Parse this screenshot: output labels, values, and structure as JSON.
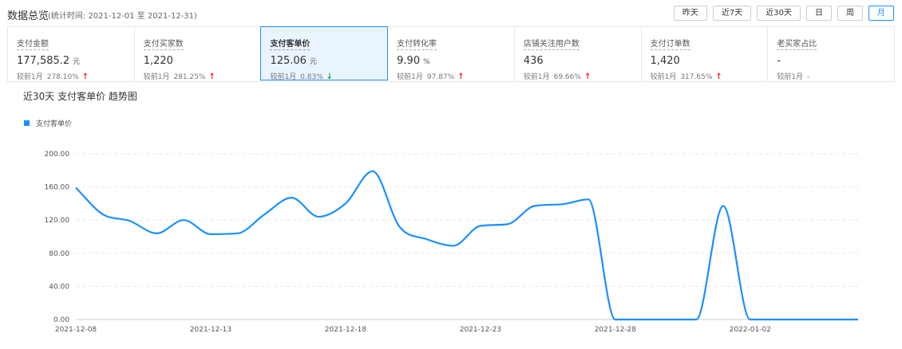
{
  "header": {
    "title": "数据总览",
    "period": "(统计时间: 2021-12-01 至 2021-12-31)",
    "range_buttons": [
      "昨天",
      "近7天",
      "近30天",
      "日",
      "周",
      "月"
    ],
    "active_range": "月"
  },
  "kpis": [
    {
      "name": "支付金额",
      "value": "177,585.2",
      "unit": "元",
      "compare_label": "较前1月",
      "compare_pct": "278.10%",
      "trend": "up"
    },
    {
      "name": "支付买家数",
      "value": "1,220",
      "unit": "",
      "compare_label": "较前1月",
      "compare_pct": "281.25%",
      "trend": "up"
    },
    {
      "name": "支付客单价",
      "value": "125.06",
      "unit": "元",
      "compare_label": "较前1月",
      "compare_pct": "0.83%",
      "trend": "down",
      "active": true
    },
    {
      "name": "支付转化率",
      "value": "9.90",
      "unit": "%",
      "compare_label": "较前1月",
      "compare_pct": "97.87%",
      "trend": "up"
    },
    {
      "name": "店铺关注用户数",
      "value": "436",
      "unit": "",
      "compare_label": "较前1月",
      "compare_pct": "69.66%",
      "trend": "up"
    },
    {
      "name": "支付订单数",
      "value": "1,420",
      "unit": "",
      "compare_label": "较前1月",
      "compare_pct": "317.65%",
      "trend": "up"
    },
    {
      "name": "老买家占比",
      "value": "-",
      "unit": "",
      "compare_label": "较前1月",
      "compare_pct": "-",
      "trend": "none"
    }
  ],
  "chart_title": "近30天 支付客单价 趋势图",
  "legend_label": "支付客单价",
  "colors": {
    "accent": "#1a90ff",
    "up": "#f5222d",
    "down": "#1aa34a"
  },
  "chart_data": {
    "type": "line",
    "title": "近30天 支付客单价 趋势图",
    "xlabel": "",
    "ylabel": "",
    "ylim": [
      0,
      200
    ],
    "y_ticks": [
      "0.00",
      "40.00",
      "80.00",
      "120.00",
      "160.00",
      "200.00"
    ],
    "x_tick_labels": [
      "2021-12-08",
      "2021-12-13",
      "2021-12-18",
      "2021-12-23",
      "2021-12-28",
      "2022-01-02"
    ],
    "grid": true,
    "legend": "top-left",
    "series": [
      {
        "name": "支付客单价",
        "x": [
          "2021-12-08",
          "2021-12-09",
          "2021-12-10",
          "2021-12-11",
          "2021-12-12",
          "2021-12-13",
          "2021-12-14",
          "2021-12-15",
          "2021-12-16",
          "2021-12-17",
          "2021-12-18",
          "2021-12-19",
          "2021-12-20",
          "2021-12-21",
          "2021-12-22",
          "2021-12-23",
          "2021-12-24",
          "2021-12-25",
          "2021-12-26",
          "2021-12-27",
          "2021-12-28",
          "2021-12-29",
          "2021-12-30",
          "2021-12-31",
          "2022-01-01",
          "2022-01-02",
          "2022-01-03",
          "2022-01-04",
          "2022-01-05",
          "2022-01-06"
        ],
        "values": [
          159,
          127,
          119,
          104,
          120,
          103,
          104,
          127,
          147,
          124,
          140,
          179,
          112,
          97,
          89,
          113,
          115,
          137,
          139,
          145,
          0,
          0,
          0,
          0,
          137,
          0,
          0,
          0,
          0,
          0
        ]
      }
    ]
  }
}
